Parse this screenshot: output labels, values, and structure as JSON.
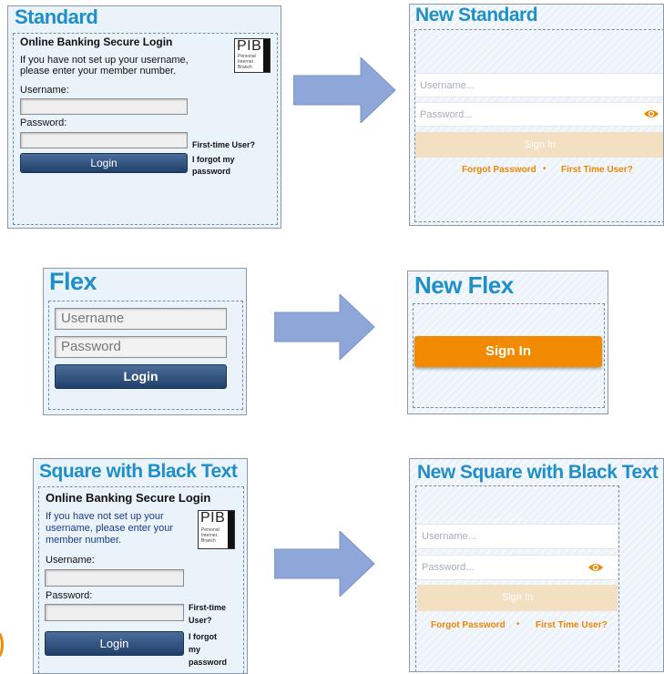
{
  "rows": {
    "standard": {
      "old": {
        "title": "Standard",
        "heading": "Online Banking Secure Login",
        "intro": [
          "If you have not set up your username,",
          "please enter your member number."
        ],
        "username_label": "Username:",
        "password_label": "Password:",
        "first_time": "First-time User?",
        "forgot": [
          "I forgot my",
          "password"
        ],
        "login": "Login",
        "pib": {
          "big": "PIB",
          "small": [
            "Personal",
            "Internet",
            "Branch"
          ]
        }
      },
      "new": {
        "title": "New Standard",
        "username_placeholder": "Username...",
        "password_placeholder": "Password...",
        "sign_in": "Sign In",
        "forgot": "Forgot Password",
        "separator": "•",
        "first_time": "First Time User?"
      }
    },
    "flex": {
      "old": {
        "title": "Flex",
        "username_placeholder": "Username",
        "password_placeholder": "Password",
        "login": "Login"
      },
      "new": {
        "title": "New Flex",
        "sign_in": "Sign In"
      }
    },
    "square": {
      "old": {
        "title": "Square with Black Text",
        "heading": "Online Banking Secure Login",
        "intro": [
          "If you have not set up your",
          "username, please enter your",
          "member number."
        ],
        "username_label": "Username:",
        "password_label": "Password:",
        "first_time": [
          "First-time",
          "User?"
        ],
        "forgot": [
          "I forgot",
          "my",
          "password"
        ],
        "login": "Login",
        "pib": {
          "big": "PIB",
          "small": [
            "Personal",
            "Internet",
            "Branch"
          ]
        }
      },
      "new": {
        "title": "New Square with Black Text",
        "username_placeholder": "Username...",
        "password_placeholder": "Password...",
        "sign_in": "Sign In",
        "forgot": "Forgot Password",
        "separator": "•",
        "first_time": "First Time User?"
      }
    }
  },
  "colors": {
    "title_blue": "#1f8fc8",
    "accent_orange": "#ef8500",
    "sign_in_disabled": "#f3dfc2",
    "sign_in_active": "#f28a00",
    "old_button_navy": "#20406b",
    "arrow_fill": "#8fa6d8",
    "panel_bg": "#eaf2fa"
  },
  "icons": {
    "arrow": "right-arrow-icon",
    "eye": "eye-icon",
    "pib": "pib-badge-icon"
  }
}
